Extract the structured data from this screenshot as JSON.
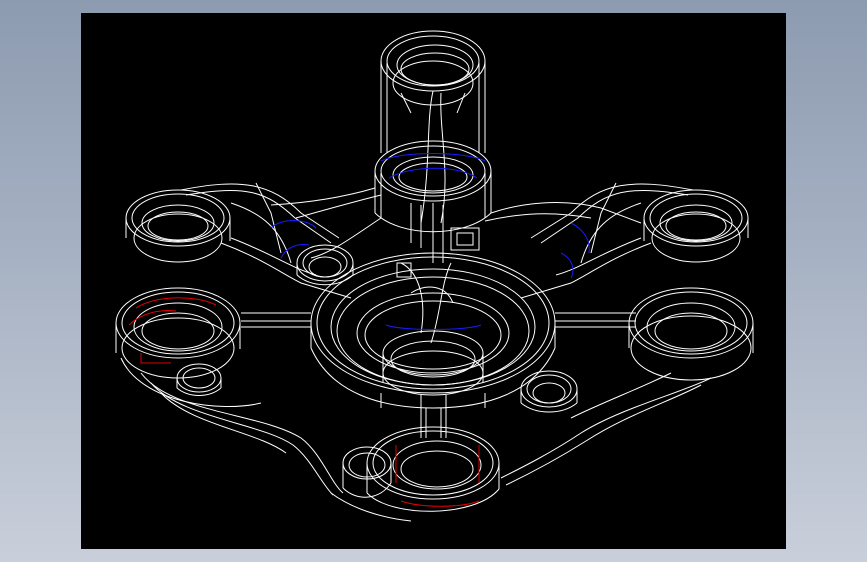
{
  "colors": {
    "backdrop_top": "#8d9bb0",
    "backdrop_bottom": "#c9cfda",
    "viewport_background": "#000000",
    "wireframe_line": "#ffffff",
    "hidden_edge": "#1a1aff",
    "section_edge": "#e00000"
  },
  "viewport": {
    "render_mode": "wireframe",
    "projection": "isometric"
  }
}
